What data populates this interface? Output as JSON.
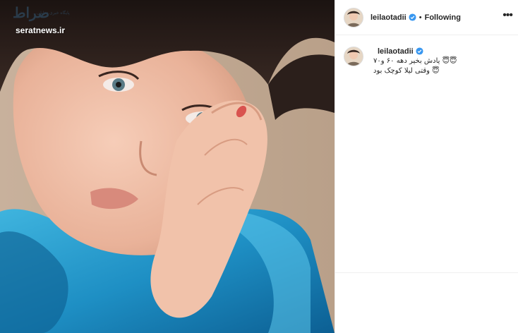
{
  "watermark": {
    "logo": "صراط",
    "tagline": "پایگاه خبری تحلیلی",
    "site": "seratnews.ir"
  },
  "photo": {
    "alt_subject": "portrait photo"
  },
  "header": {
    "username": "leilaotadii",
    "separator": "•",
    "follow_state": "Following",
    "more_icon": "more-horizontal-icon"
  },
  "caption": {
    "username": "leilaotadii",
    "text": "یادش بخیر دهه ۶۰ و۷۰ 😇😇\nوقتی لیلا کوچک بود 😇"
  },
  "colors": {
    "verified_badge": "#3897f0",
    "text": "#262626",
    "border": "#efefef",
    "shirt": "#1e8fc4"
  }
}
